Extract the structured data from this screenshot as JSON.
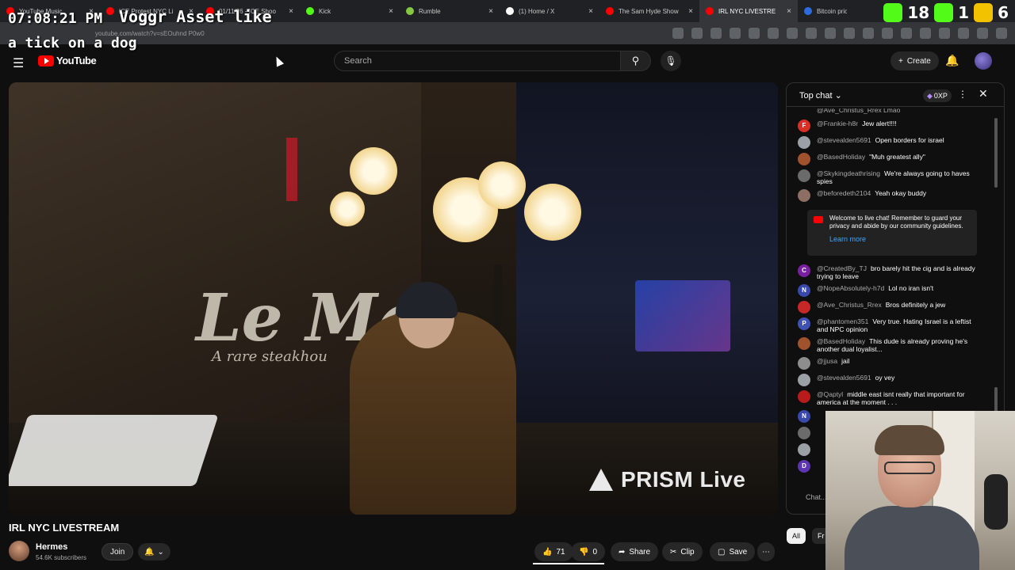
{
  "browser": {
    "tabs": [
      {
        "title": "YouTube Music",
        "color": "#ff0000"
      },
      {
        "title": "ICE Protest NYC Li",
        "color": "#ff0000"
      },
      {
        "title": "01/11/26 - ICE Shoo",
        "color": "#ff0000"
      },
      {
        "title": "Kick",
        "color": "#53fc18"
      },
      {
        "title": "Rumble",
        "color": "#85c742"
      },
      {
        "title": "(1) Home / X",
        "color": "#ffffff"
      },
      {
        "title": "The Sam Hyde Show",
        "color": "#ff0000"
      },
      {
        "title": "IRL NYC LIVESTRE",
        "color": "#ff0000",
        "active": true
      },
      {
        "title": "Bitcoin price tod",
        "color": "#2d6cdf"
      }
    ],
    "url": "youtube.com/watch?v=sEOuhnd P0w0"
  },
  "overlay": {
    "time": "07:08:21 PM",
    "brand": "Voggr  Asset like",
    "caption": "a tick on a dog",
    "counters": [
      {
        "value": "18",
        "color": "#53fc18"
      },
      {
        "value": "1",
        "color": "#53fc18"
      },
      {
        "value": "6",
        "color": "#f2c200"
      }
    ]
  },
  "yt": {
    "logo": "YouTube",
    "search_placeholder": "Search",
    "create_label": "Create"
  },
  "video": {
    "sign_text": "Le Ma",
    "sign_sub": "A rare steakhou",
    "watermark": "PRISM Live",
    "title": "IRL NYC LIVESTREAM",
    "channel": "Hermes",
    "subscribers": "54.6K subscribers",
    "join_label": "Join",
    "likes": "71",
    "dislikes": "0",
    "share_label": "Share",
    "clip_label": "Clip",
    "save_label": "Save"
  },
  "chat": {
    "header": "Top chat",
    "xp": "0XP",
    "partial_top": "@Ave_Christus_Rrex  Lmao",
    "messages": [
      {
        "initial": "F",
        "color": "#d93025",
        "user": "@Frankie-h8r",
        "text": "Jew alert!!!!"
      },
      {
        "initial": "",
        "color": "#9aa0a6",
        "user": "@stevealden5691",
        "text": "Open borders for israel"
      },
      {
        "initial": "",
        "color": "#a0522d",
        "user": "@BasedHoliday",
        "text": "\"Muh greatest ally\""
      },
      {
        "initial": "",
        "color": "#6b6b6b",
        "user": "@Skykingdeathrising",
        "text": "We're always going to haves spies"
      },
      {
        "initial": "",
        "color": "#8d6e63",
        "user": "@beforedeth2104",
        "text": "Yeah okay buddy"
      }
    ],
    "notice": {
      "text": "Welcome to live chat! Remember to guard your privacy and abide by our community guidelines.",
      "link": "Learn more"
    },
    "messages2": [
      {
        "initial": "C",
        "color": "#7b1fa2",
        "user": "@CreatedBy_TJ",
        "text": "bro barely hit the cig and is already trying to leave"
      },
      {
        "initial": "N",
        "color": "#3949ab",
        "user": "@NopeAbsolutely-h7d",
        "text": "Lol no iran isn't"
      },
      {
        "initial": "",
        "color": "#c62828",
        "user": "@Ave_Christus_Rrex",
        "text": "Bros definitely a jew"
      },
      {
        "initial": "P",
        "color": "#3f51b5",
        "user": "@phantomen351",
        "text": "Very true. Hating Israel is a leftist and NPC opinion"
      },
      {
        "initial": "",
        "color": "#a0522d",
        "user": "@BasedHoliday",
        "text": "This dude is already proving he's another dual loyalist..."
      },
      {
        "initial": "",
        "color": "#8d8d8d",
        "user": "@jjusa",
        "text": "jail"
      },
      {
        "initial": "",
        "color": "#9aa0a6",
        "user": "@stevealden5691",
        "text": "oy vey"
      },
      {
        "initial": "",
        "color": "#b71c1c",
        "user": "@Qaptyl",
        "text": "middle east isnt really that important for america at the moment . . ."
      }
    ],
    "partial_bottom": [
      {
        "initial": "N",
        "color": "#3949ab"
      },
      {
        "initial": "",
        "color": "#6b6b6b"
      },
      {
        "initial": "",
        "color": "#9aa0a6"
      },
      {
        "initial": "D",
        "color": "#5e35b1"
      }
    ],
    "input_placeholder": "Chat...",
    "filter_all": "All",
    "filter_more": "Fr"
  }
}
